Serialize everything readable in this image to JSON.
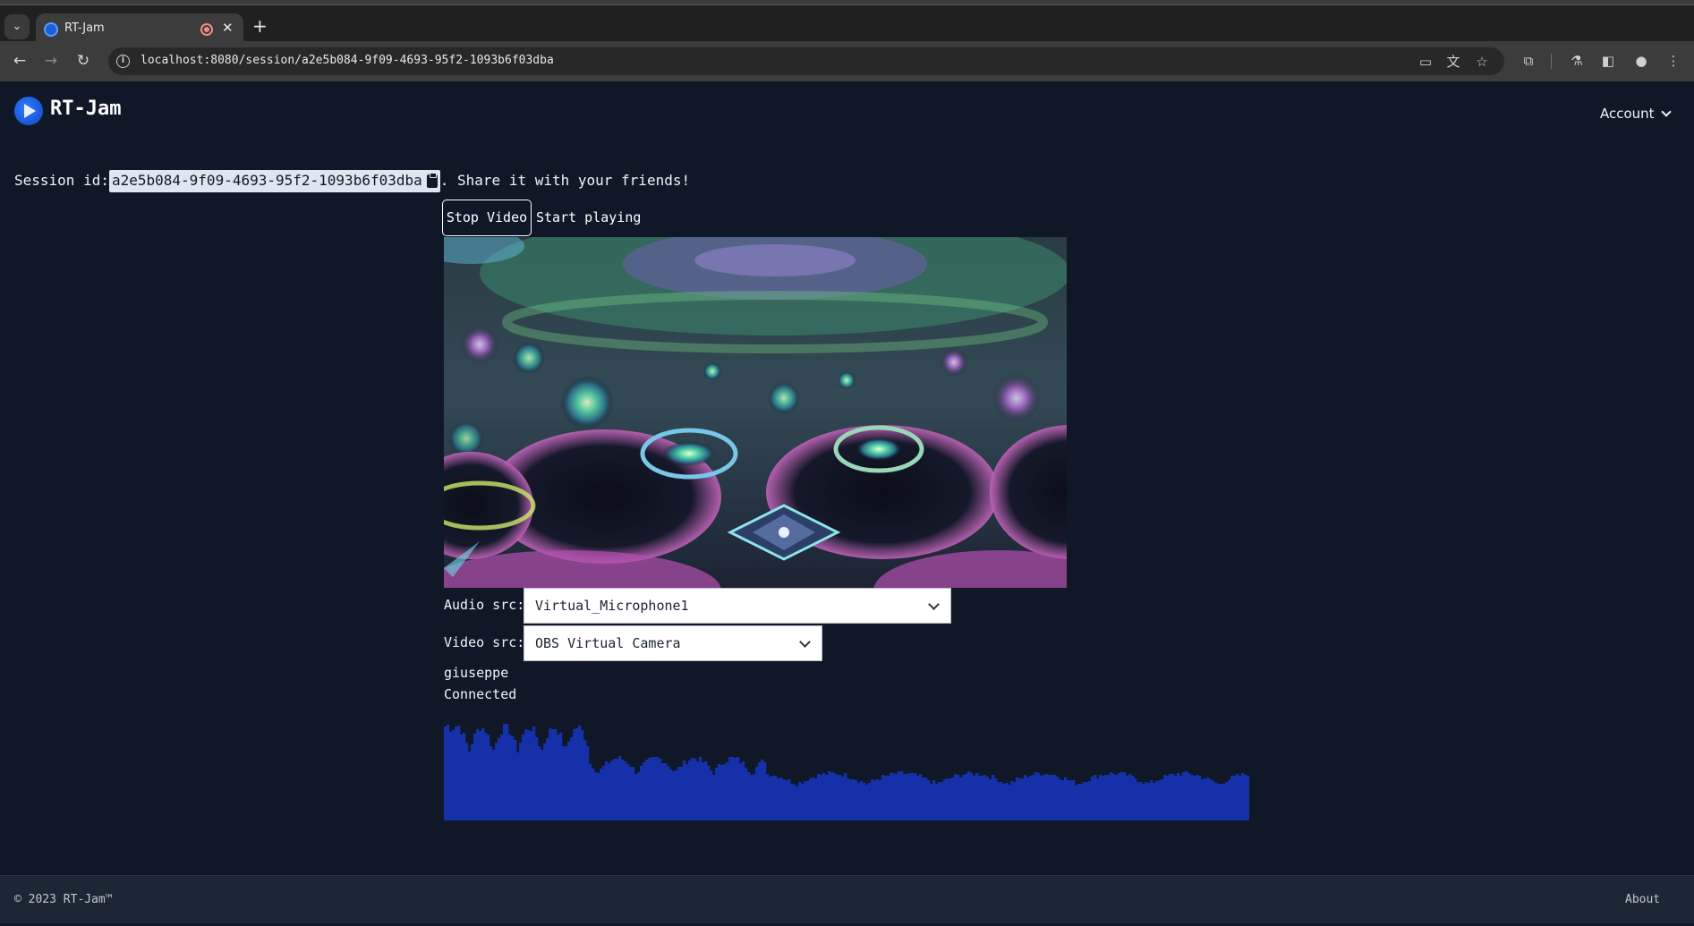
{
  "browser": {
    "tab_title": "RT-Jam",
    "url": "localhost:8080/session/a2e5b084-9f09-4693-95f2-1093b6f03dba"
  },
  "header": {
    "brand": "RT-Jam",
    "account_label": "Account"
  },
  "session": {
    "prefix": "Session id:",
    "id": "a2e5b084-9f09-4693-95f2-1093b6f03dba",
    "suffix": ". Share it with your friends!"
  },
  "controls": {
    "stop_video": "Stop Video",
    "start_playing": "Start playing"
  },
  "audio_src": {
    "label": "Audio src:",
    "value": "Virtual_Microphone1"
  },
  "video_src": {
    "label": "Video src:",
    "value": "OBS Virtual Camera"
  },
  "peer": {
    "name": "giuseppe",
    "status": "Connected"
  },
  "footer": {
    "copyright": "© 2023 RT-Jam™",
    "about": "About"
  },
  "colors": {
    "page_bg": "#101828",
    "meter_bar": "#1530a8",
    "accent": "#1c5fd8"
  }
}
